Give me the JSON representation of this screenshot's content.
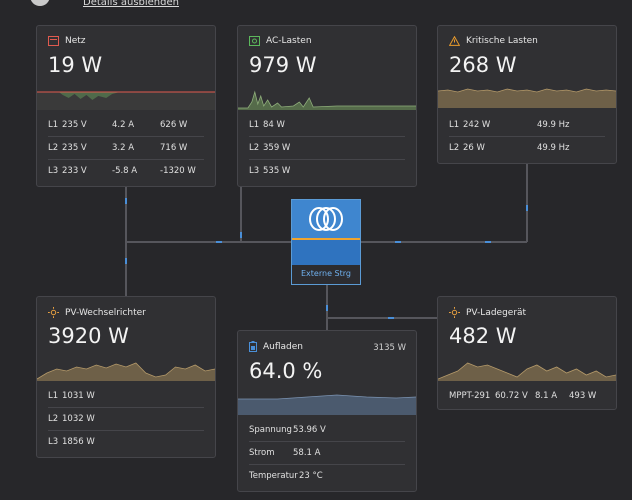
{
  "top": {
    "details_link": "Details ausblenden"
  },
  "netz": {
    "title": "Netz",
    "value": "19 W",
    "rows": [
      [
        "L1",
        "235 V",
        "4.2 A",
        "626 W"
      ],
      [
        "L2",
        "235 V",
        "3.2 A",
        "716 W"
      ],
      [
        "L3",
        "233 V",
        "-5.8 A",
        "-1320 W"
      ]
    ]
  },
  "ac": {
    "title": "AC-Lasten",
    "value": "979 W",
    "rows": [
      [
        "L1",
        "84 W"
      ],
      [
        "L2",
        "359 W"
      ],
      [
        "L3",
        "535 W"
      ]
    ]
  },
  "krit": {
    "title": "Kritische Lasten",
    "value": "268 W",
    "rows": [
      [
        "L1",
        "242 W",
        "49.9 Hz"
      ],
      [
        "L2",
        "26 W",
        "49.9 Hz"
      ]
    ]
  },
  "hub": {
    "label": "Externe Strg"
  },
  "pv_wr": {
    "title": "PV-Wechselrichter",
    "value": "3920 W",
    "rows": [
      [
        "L1",
        "1031 W"
      ],
      [
        "L2",
        "1032 W"
      ],
      [
        "L3",
        "1856 W"
      ]
    ]
  },
  "bat": {
    "title": "Aufladen",
    "power": "3135 W",
    "value": "64.0 %",
    "rows": [
      [
        "Spannung",
        "53.96 V"
      ],
      [
        "Strom",
        "58.1 A"
      ],
      [
        "Temperatur",
        "23 °C"
      ]
    ]
  },
  "pv_lg": {
    "title": "PV-Ladegerät",
    "value": "482 W",
    "row": [
      "MPPT-291",
      "60.72 V",
      "8.1 A",
      "493 W"
    ]
  },
  "colors": {
    "accent_blue": "#3f86cf",
    "grid_red": "#e05a4f",
    "ac_green": "#5cb85c",
    "warn_orange": "#e89a2c",
    "solar": "#e8a040"
  }
}
